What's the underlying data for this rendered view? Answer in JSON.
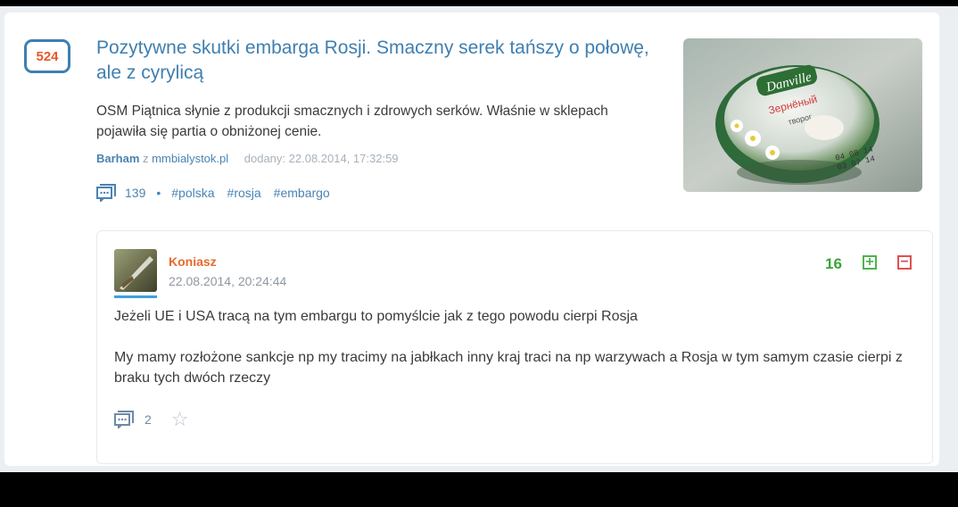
{
  "post": {
    "votes": "524",
    "title": "Pozytywne skutki embarga Rosji. Smaczny serek tańszy o połowę, ale z cyrylicą",
    "description": "OSM Piątnica słynie z produkcji smacznych i zdrowych serków. Właśnie w sklepach pojawiła się partia o obniżonej cenie.",
    "author": "Barham",
    "from_word": "z",
    "source": "mmbialystok.pl",
    "added": "dodany: 22.08.2014, 17:32:59",
    "comment_count": "139",
    "tags": [
      "#polska",
      "#rosja",
      "#embargo"
    ],
    "thumbnail_label": "Danville Зернёный творог"
  },
  "comment": {
    "author": "Koniasz",
    "date": "22.08.2014, 20:24:44",
    "score": "16",
    "plus_label": "+",
    "minus_label": "−",
    "paragraphs": [
      "Jeżeli UE i USA tracą na tym embargu to pomyślcie jak z tego powodu cierpi Rosja",
      "My mamy rozłożone sankcje np my tracimy na jabłkach inny kraj traci na np warzywach a Rosja w tym samym czasie cierpi z braku tych dwóch rzeczy"
    ],
    "reply_count": "2"
  },
  "icons": {
    "comments": "comment-bubble-icon",
    "favorite": "star-icon"
  },
  "colors": {
    "title": "#3f7fb0",
    "votes": "#e8582c",
    "comment_author": "#e8682c",
    "plus": "#4fb34f",
    "minus": "#e05050"
  }
}
